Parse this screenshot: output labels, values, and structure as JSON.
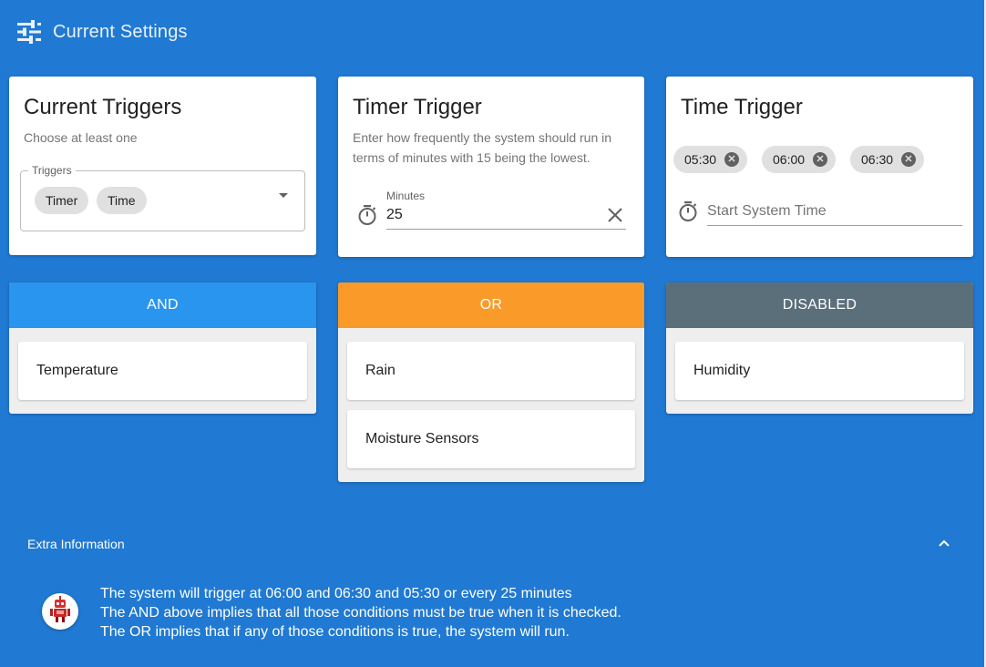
{
  "header": {
    "title": "Current Settings",
    "icon": "tune-icon"
  },
  "triggers_card": {
    "title": "Current Triggers",
    "subtitle": "Choose at least one",
    "select_label": "Triggers",
    "chips": [
      "Timer",
      "Time"
    ]
  },
  "timer_card": {
    "title": "Timer Trigger",
    "description_line1": "Enter how frequently the system should run in",
    "description_line2": "terms of minutes with 15 being the lowest.",
    "field_label": "Minutes",
    "field_value": "25"
  },
  "time_card": {
    "title": "Time Trigger",
    "chips": [
      "05:30",
      "06:00",
      "06:30"
    ],
    "placeholder": "Start System Time"
  },
  "groups": {
    "and": {
      "label": "AND",
      "color": "#2a95ee",
      "items": [
        "Temperature"
      ]
    },
    "or": {
      "label": "OR",
      "color": "#fa9a28",
      "items": [
        "Rain",
        "Moisture Sensors"
      ]
    },
    "disabled": {
      "label": "DISABLED",
      "color": "#5b6f7b",
      "items": [
        "Humidity"
      ]
    }
  },
  "extra": {
    "title": "Extra Information",
    "lines": [
      "The system will trigger at 06:00 and 06:30 and 05:30 or every 25 minutes",
      "The AND above implies that all those conditions must be true when it is checked.",
      "The OR implies that if any of those conditions is true, the system will run."
    ]
  },
  "colors": {
    "background": "#2079d2",
    "card": "#ffffff"
  }
}
